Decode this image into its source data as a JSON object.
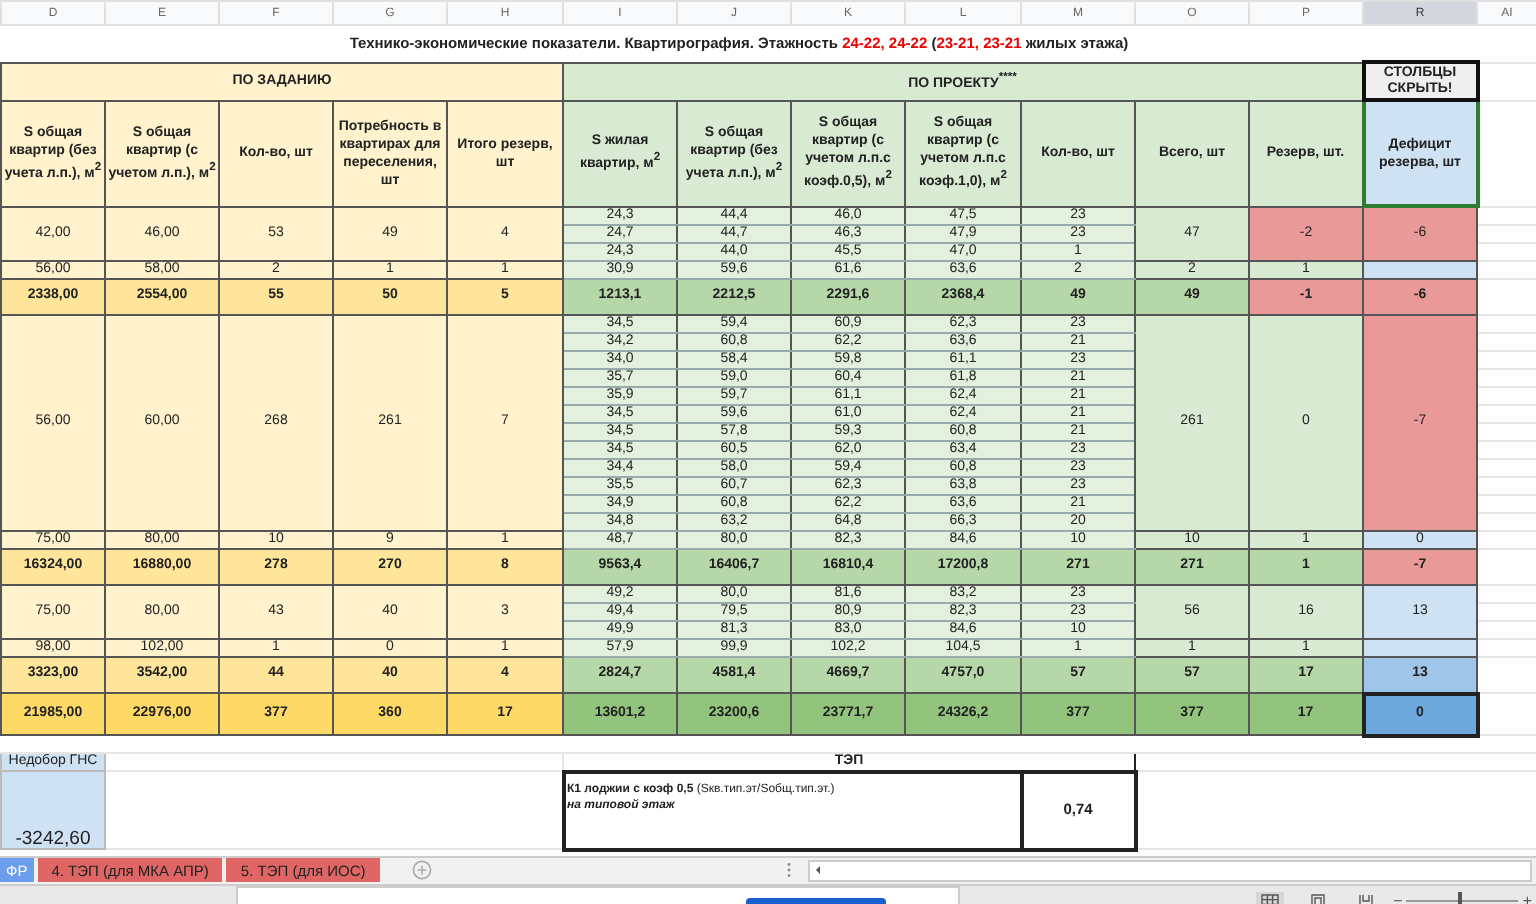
{
  "column_letters": [
    {
      "label": "D",
      "selected": false
    },
    {
      "label": "E",
      "selected": false
    },
    {
      "label": "F",
      "selected": false
    },
    {
      "label": "G",
      "selected": false
    },
    {
      "label": "H",
      "selected": false
    },
    {
      "label": "I",
      "selected": false
    },
    {
      "label": "J",
      "selected": false
    },
    {
      "label": "K",
      "selected": false
    },
    {
      "label": "L",
      "selected": false
    },
    {
      "label": "M",
      "selected": false
    },
    {
      "label": "O",
      "selected": false
    },
    {
      "label": "P",
      "selected": false
    },
    {
      "label": "R",
      "selected": true
    },
    {
      "label": "AI",
      "selected": false
    }
  ],
  "title": [
    {
      "text": "Технико-экономические показатели. Квартирография. Этажность ",
      "highlight": false
    },
    {
      "text": "24-22, 24-22",
      "highlight": true
    },
    {
      "text": " (",
      "highlight": false
    },
    {
      "text": "23-21, 23-21",
      "highlight": true
    },
    {
      "text": " жилых этажа)",
      "highlight": false
    }
  ],
  "sections": [
    "ПО ЗАДАНИЮ",
    "ПО ПРОЕКТУ$^{****}$",
    "СТОЛБЦЫ СКРЫТЬ!"
  ],
  "headers": [
    "S общая квартир (без учета л.п.), м$^{2}$",
    "S общая квартир (с учетом л.п.), м$^{2}$",
    "Кол-во, шт",
    "Потребность в квартирах для переселения, шт",
    "Итого резерв, шт",
    "S жилая квартир, м$^{2}$",
    "S общая квартир (без учета л.п.), м$^{2}$",
    "S общая квартир (с учетом л.п.с коэф.0,5), м$^{2}$",
    "S общая квартир (с учетом л.п.с коэф.1,0), м$^{2}$",
    "Кол-во, шт",
    "Всего, шт",
    "Резерв, шт.",
    "Дефицит резерва, шт"
  ],
  "rows": [
    {
      "kind": "group",
      "task": [
        "42,00",
        "46,00",
        "53",
        "49",
        "4"
      ],
      "units": [
        [
          "24,3",
          "44,4",
          "46,0",
          "47,5",
          "23"
        ],
        [
          "24,7",
          "44,7",
          "46,3",
          "47,9",
          "23"
        ],
        [
          "24,3",
          "44,0",
          "45,5",
          "47,0",
          "1"
        ]
      ],
      "total": "47",
      "reserve": {
        "value": "-2",
        "deficit": true
      },
      "shortfall": {
        "value": "-6",
        "deficit": true
      }
    },
    {
      "kind": "group",
      "task": [
        "56,00",
        "58,00",
        "2",
        "1",
        "1"
      ],
      "units": [
        [
          "30,9",
          "59,6",
          "61,6",
          "63,6",
          "2"
        ]
      ],
      "total": "2",
      "reserve": {
        "value": "1",
        "deficit": false
      },
      "shortfall": {
        "deficit": false
      }
    },
    {
      "kind": "subtotal",
      "task": [
        "2338,00",
        "2554,00",
        "55",
        "50",
        "5"
      ],
      "project": [
        "1213,1",
        "2212,5",
        "2291,6",
        "2368,4",
        "49"
      ],
      "total": "49",
      "reserve": {
        "value": "-1",
        "deficit": true
      },
      "shortfall": {
        "value": "-6",
        "deficit": true
      }
    },
    {
      "kind": "group",
      "task": [
        "56,00",
        "60,00",
        "268",
        "261",
        "7"
      ],
      "units": [
        [
          "34,5",
          "59,4",
          "60,9",
          "62,3",
          "23"
        ],
        [
          "34,2",
          "60,8",
          "62,2",
          "63,6",
          "21"
        ],
        [
          "34,0",
          "58,4",
          "59,8",
          "61,1",
          "23"
        ],
        [
          "35,7",
          "59,0",
          "60,4",
          "61,8",
          "21"
        ],
        [
          "35,9",
          "59,7",
          "61,1",
          "62,4",
          "21"
        ],
        [
          "34,5",
          "59,6",
          "61,0",
          "62,4",
          "21"
        ],
        [
          "34,5",
          "57,8",
          "59,3",
          "60,8",
          "21"
        ],
        [
          "34,5",
          "60,5",
          "62,0",
          "63,4",
          "23"
        ],
        [
          "34,4",
          "58,0",
          "59,4",
          "60,8",
          "23"
        ],
        [
          "35,5",
          "60,7",
          "62,3",
          "63,8",
          "23"
        ],
        [
          "34,9",
          "60,8",
          "62,2",
          "63,6",
          "21"
        ],
        [
          "34,8",
          "63,2",
          "64,8",
          "66,3",
          "20"
        ]
      ],
      "total": "261",
      "reserve": {
        "value": "0",
        "deficit": false
      },
      "shortfall": {
        "value": "-7",
        "deficit": true
      }
    },
    {
      "kind": "group",
      "task": [
        "75,00",
        "80,00",
        "10",
        "9",
        "1"
      ],
      "units": [
        [
          "48,7",
          "80,0",
          "82,3",
          "84,6",
          "10"
        ]
      ],
      "total": "10",
      "reserve": {
        "value": "1",
        "deficit": false
      },
      "shortfall": {
        "value": "0",
        "deficit": false
      }
    },
    {
      "kind": "subtotal",
      "task": [
        "16324,00",
        "16880,00",
        "278",
        "270",
        "8"
      ],
      "project": [
        "9563,4",
        "16406,7",
        "16810,4",
        "17200,8",
        "271"
      ],
      "total": "271",
      "reserve": {
        "value": "1",
        "deficit": false
      },
      "shortfall": {
        "value": "-7",
        "deficit": true
      }
    },
    {
      "kind": "group",
      "task": [
        "75,00",
        "80,00",
        "43",
        "40",
        "3"
      ],
      "units": [
        [
          "49,2",
          "80,0",
          "81,6",
          "83,2",
          "23"
        ],
        [
          "49,4",
          "79,5",
          "80,9",
          "82,3",
          "23"
        ],
        [
          "49,9",
          "81,3",
          "83,0",
          "84,6",
          "10"
        ]
      ],
      "total": "56",
      "reserve": {
        "value": "16",
        "deficit": false
      },
      "shortfall": {
        "value": "13",
        "deficit": false
      }
    },
    {
      "kind": "group",
      "task": [
        "98,00",
        "102,00",
        "1",
        "0",
        "1"
      ],
      "units": [
        [
          "57,9",
          "99,9",
          "102,2",
          "104,5",
          "1"
        ]
      ],
      "total": "1",
      "reserve": {
        "value": "1",
        "deficit": false
      },
      "shortfall": {
        "deficit": false
      }
    },
    {
      "kind": "subtotal",
      "task": [
        "3323,00",
        "3542,00",
        "44",
        "40",
        "4"
      ],
      "project": [
        "2824,7",
        "4581,4",
        "4669,7",
        "4757,0",
        "57"
      ],
      "total": "57",
      "reserve": {
        "value": "17",
        "deficit": false
      },
      "shortfall": {
        "value": "13",
        "deficit": false
      }
    },
    {
      "kind": "grand_total",
      "task": [
        "21985,00",
        "22976,00",
        "377",
        "360",
        "17"
      ],
      "project": [
        "13601,2",
        "23200,6",
        "23771,7",
        "24326,2",
        "377"
      ],
      "total": "377",
      "reserve": {
        "value": "17",
        "deficit": false
      },
      "shortfall": {
        "value": "0",
        "deficit": false
      }
    }
  ],
  "shortage": {
    "label": "Недобор ГНС",
    "value": "-3242,60"
  },
  "tep": {
    "title": "ТЭП",
    "label": "К1 лоджии с коэф 0,5",
    "formula": "(Sкв.тип.эт/Sобщ.тип.эт.)",
    "note": "на типовой этаж",
    "value": "0,74"
  },
  "sheet_tabs": [
    {
      "label": "ФР",
      "selected": true
    },
    {
      "label": "4. ТЭП (для МКА АПР)",
      "selected": false
    },
    {
      "label": "5. ТЭП (для ИОС)",
      "selected": false
    }
  ],
  "zoom": {
    "minus": "−",
    "plus": "+",
    "level": 0.45
  }
}
